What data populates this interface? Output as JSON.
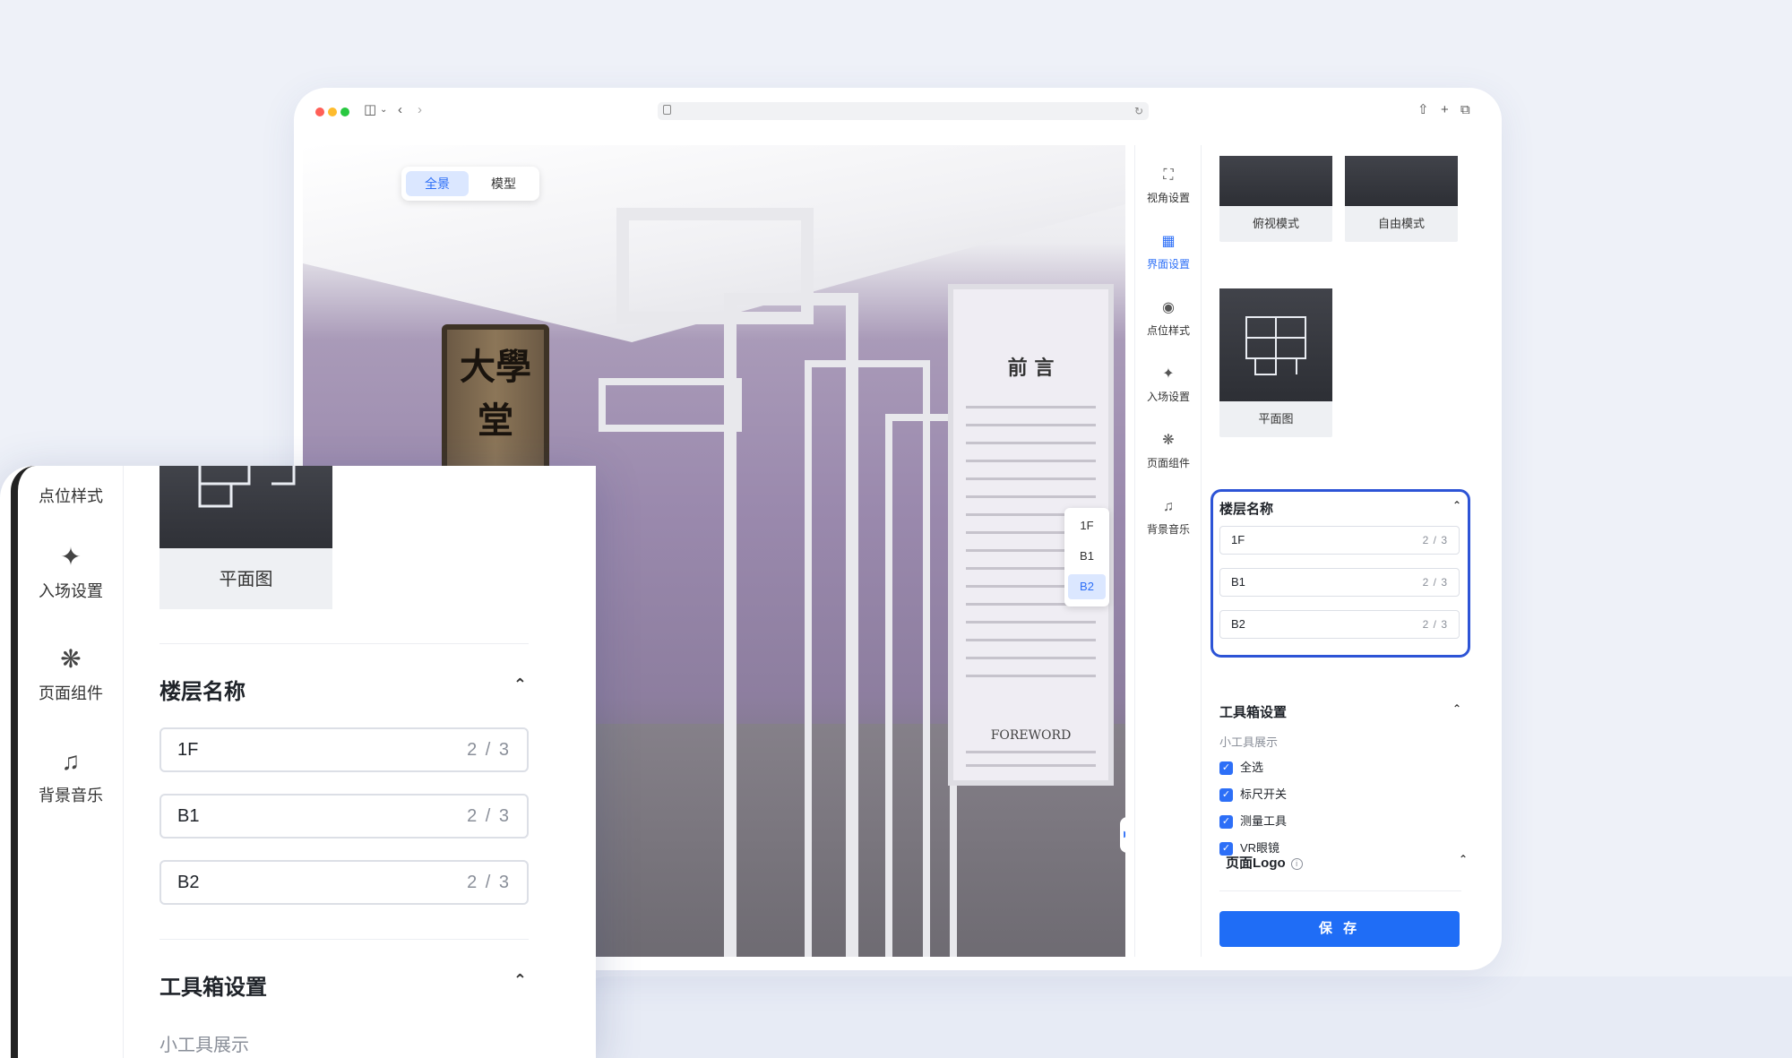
{
  "colors": {
    "accent": "#2d6ff7",
    "highlight_border": "#2d54d6",
    "save_button": "#1f6df6"
  },
  "browser": {
    "traffic_lights": [
      "#ff5f57",
      "#febc2e",
      "#28c840"
    ],
    "toolbar_icons": [
      "sidebar-icon",
      "chevron-down-icon",
      "back-icon",
      "forward-icon",
      "share-icon",
      "plus-icon",
      "tabs-icon"
    ]
  },
  "pano": {
    "view_toggle": [
      "全景",
      "模型"
    ],
    "sign_text": "大學堂",
    "board_title": "前 言",
    "board_subtitle": "FOREWORD",
    "floor_switch": {
      "options": [
        "1F",
        "B1",
        "B2"
      ],
      "selected": "B2"
    }
  },
  "nav": [
    {
      "label": "视角设置",
      "icon": "viewpoint-icon",
      "active": false
    },
    {
      "label": "界面设置",
      "icon": "interface-icon",
      "active": true
    },
    {
      "label": "点位样式",
      "icon": "location-pin-icon",
      "active": false
    },
    {
      "label": "入场设置",
      "icon": "sparkle-icon",
      "active": false
    },
    {
      "label": "页面组件",
      "icon": "puzzle-icon",
      "active": false
    },
    {
      "label": "背景音乐",
      "icon": "music-note-icon",
      "active": false
    }
  ],
  "panel": {
    "modes": [
      "俯视模式",
      "自由模式",
      "平面图"
    ],
    "floor_section": {
      "title": "楼层名称",
      "floors": [
        {
          "name": "1F",
          "count": "2 / 3"
        },
        {
          "name": "B1",
          "count": "2 / 3"
        },
        {
          "name": "B2",
          "count": "2 / 3"
        }
      ]
    },
    "toolbox_section": {
      "title": "工具箱设置",
      "subtitle": "小工具展示",
      "options": [
        "全选",
        "标尺开关",
        "测量工具",
        "VR眼镜"
      ]
    },
    "logo_section": {
      "title": "页面Logo"
    },
    "save_label": "保 存"
  },
  "zoom": {
    "nav": [
      "点位样式",
      "入场设置",
      "页面组件",
      "背景音乐"
    ],
    "thumb_caption": "平面图",
    "floor_title": "楼层名称",
    "floors": [
      {
        "name": "1F",
        "count": "2 / 3"
      },
      {
        "name": "B1",
        "count": "2 / 3"
      },
      {
        "name": "B2",
        "count": "2 / 3"
      }
    ],
    "toolbox_title": "工具箱设置",
    "toolbox_subtitle": "小工具展示"
  }
}
